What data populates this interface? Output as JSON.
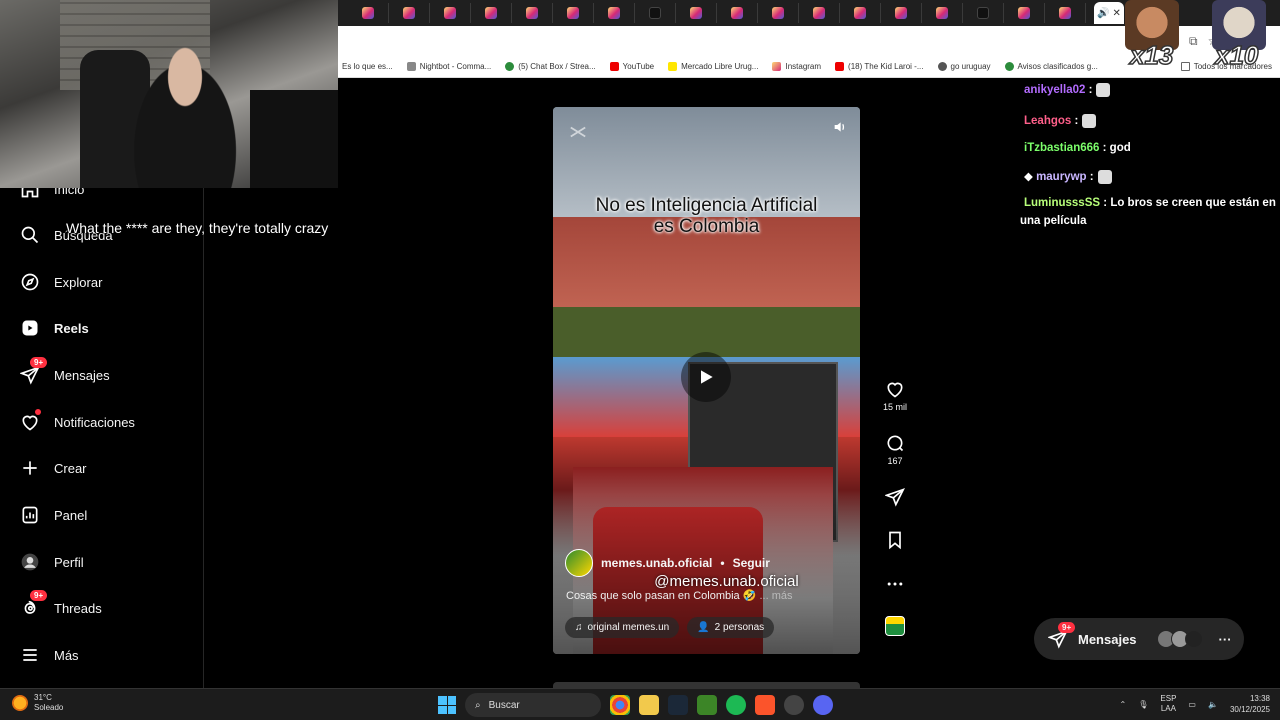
{
  "browser": {
    "bookmarks": [
      {
        "label": "Es lo que es...",
        "icon": "page-icon"
      },
      {
        "label": "Nightbot - Comma...",
        "icon": "nightbot-icon"
      },
      {
        "label": "(5) Chat Box / Strea...",
        "icon": "chatbox-icon"
      },
      {
        "label": "YouTube",
        "icon": "youtube-icon"
      },
      {
        "label": "Mercado Libre Urug...",
        "icon": "mercadolibre-icon"
      },
      {
        "label": "Instagram",
        "icon": "instagram-icon"
      },
      {
        "label": "(18) The Kid Laroi -...",
        "icon": "youtube-icon"
      },
      {
        "label": "go uruguay",
        "icon": "globe-icon"
      },
      {
        "label": "Avisos clasificados g...",
        "icon": "classifieds-icon"
      }
    ],
    "all_bookmarks": "Todos los marcadores"
  },
  "stream": {
    "subtitle": "What the **** are they, they're totally crazy",
    "multipliers": [
      "x13",
      "x10"
    ]
  },
  "sidebar": {
    "items": [
      {
        "label": "Inicio",
        "icon": "home-icon",
        "active": false
      },
      {
        "label": "Búsqueda",
        "icon": "search-icon",
        "active": false
      },
      {
        "label": "Explorar",
        "icon": "compass-icon",
        "active": false
      },
      {
        "label": "Reels",
        "icon": "reels-icon",
        "active": true
      },
      {
        "label": "Mensajes",
        "icon": "messenger-icon",
        "badge": "9+"
      },
      {
        "label": "Notificaciones",
        "icon": "heart-icon",
        "dot": true
      },
      {
        "label": "Crear",
        "icon": "plus-icon"
      },
      {
        "label": "Panel",
        "icon": "dashboard-icon"
      },
      {
        "label": "Perfil",
        "icon": "profile-icon"
      },
      {
        "label": "Threads",
        "icon": "threads-icon",
        "badge": "9+"
      },
      {
        "label": "Más",
        "icon": "menu-icon"
      }
    ]
  },
  "reel": {
    "caption_line1": "No es Inteligencia Artificial",
    "caption_line2": "es Colombia",
    "author": "memes.unab.oficial",
    "separator": "•",
    "follow": "Seguir",
    "handle_overlay": "@memes.unab.oficial",
    "description": "Cosas que solo pasan en Colombia 🤣",
    "more": "... más",
    "audio_chip": "original   memes.un",
    "people_chip": "2 personas",
    "likes": "15 mil",
    "comments": "167"
  },
  "chat": {
    "messages": [
      {
        "user": "anikyella02",
        "sep": ":",
        "text": ""
      },
      {
        "user": "Leahgos",
        "sep": ":",
        "text": ""
      },
      {
        "user": "iTzbastian666",
        "sep": ":",
        "text": "god"
      },
      {
        "user": "maurywp",
        "sep": ":",
        "text": ""
      },
      {
        "user": "LuminusssSS",
        "sep": ":",
        "text": "Lo bros se creen que están en",
        "text2": "una película"
      }
    ]
  },
  "messages_pill": {
    "label": "Mensajes",
    "badge": "9+"
  },
  "taskbar": {
    "temperature": "31°C",
    "weather": "Soleado",
    "search": "Buscar",
    "lang1": "ESP",
    "lang2": "LAA",
    "time": "13:38",
    "date": "30/12/2025"
  }
}
